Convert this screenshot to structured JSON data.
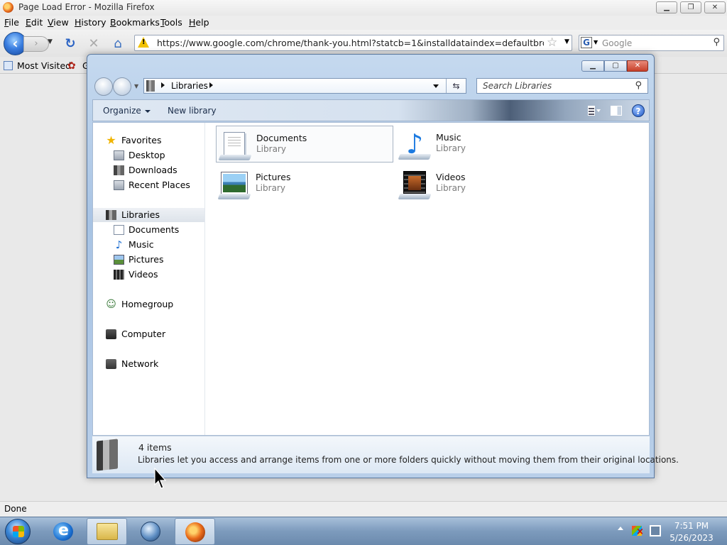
{
  "firefox": {
    "title": "Page Load Error - Mozilla Firefox",
    "menu": [
      "File",
      "Edit",
      "View",
      "History",
      "Bookmarks",
      "Tools",
      "Help"
    ],
    "url": "https://www.google.com/chrome/thank-you.html?statcb=1&installdataindex=defaultbrowser&default",
    "search_placeholder": "Google",
    "bookmark_most_visited": "Most Visited",
    "bookmark_partial": "G",
    "status": "Done"
  },
  "explorer": {
    "breadcrumb": "Libraries",
    "search_placeholder": "Search Libraries",
    "commands": {
      "organize": "Organize",
      "new_library": "New library"
    },
    "nav": {
      "favorites": "Favorites",
      "favorites_items": [
        "Desktop",
        "Downloads",
        "Recent Places"
      ],
      "libraries": "Libraries",
      "libraries_items": [
        "Documents",
        "Music",
        "Pictures",
        "Videos"
      ],
      "homegroup": "Homegroup",
      "computer": "Computer",
      "network": "Network"
    },
    "libraries": [
      {
        "name": "Documents",
        "type": "Library",
        "icon": "documents-library-icon"
      },
      {
        "name": "Music",
        "type": "Library",
        "icon": "music-library-icon"
      },
      {
        "name": "Pictures",
        "type": "Library",
        "icon": "pictures-library-icon"
      },
      {
        "name": "Videos",
        "type": "Library",
        "icon": "videos-library-icon"
      }
    ],
    "details": {
      "count": "4 items",
      "description": "Libraries let you access and arrange items from one or more folders quickly without moving them from their original locations."
    }
  },
  "taskbar": {
    "time": "7:51 PM",
    "date": "5/26/2023",
    "pinned": [
      "internet-explorer-icon",
      "windows-explorer-icon",
      "windows-media-player-icon",
      "firefox-icon"
    ]
  }
}
